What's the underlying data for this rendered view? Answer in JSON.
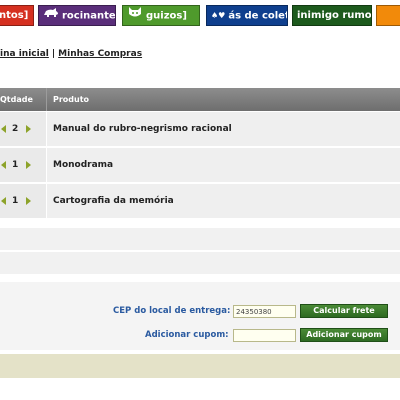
{
  "nav": {
    "tabs": [
      {
        "label": "ntos]",
        "icon": "none",
        "color": "#d53020"
      },
      {
        "label": "rocinante]",
        "icon": "rhino-icon",
        "color": "#5a2e7a"
      },
      {
        "label": "guizos]",
        "icon": "cat-face-icon",
        "color": "#4f9a2c"
      },
      {
        "label": "ás de colete",
        "icon": "card-suits-icon",
        "color": "#0f3f8e"
      },
      {
        "label": "inimigo rumor]",
        "icon": "none",
        "color": "#1d5a1d"
      },
      {
        "label": "",
        "icon": "none",
        "color": "#f28a0a"
      }
    ]
  },
  "breadcrumb": {
    "home": "ina inicial",
    "separator": "|",
    "current": "Minhas Compras"
  },
  "cart": {
    "headers": {
      "qty": "Qtdade",
      "product": "Produto"
    },
    "items": [
      {
        "qty": "2",
        "product": "Manual do rubro-negrismo racional"
      },
      {
        "qty": "1",
        "product": "Monodrama"
      },
      {
        "qty": "1",
        "product": "Cartografia da memória"
      }
    ]
  },
  "shipping": {
    "cep_label": "CEP do local de entrega:",
    "cep_value": "24350380",
    "calc_button": "Calcular frete",
    "coupon_label": "Adicionar cupom:",
    "coupon_value": "",
    "coupon_button": "Adicionar cupom"
  },
  "colors": {
    "accent_green": "#2d6a22",
    "arrow_green": "#8da32a",
    "label_blue": "#2a5aa0",
    "header_gray": "#7a7a7a"
  }
}
